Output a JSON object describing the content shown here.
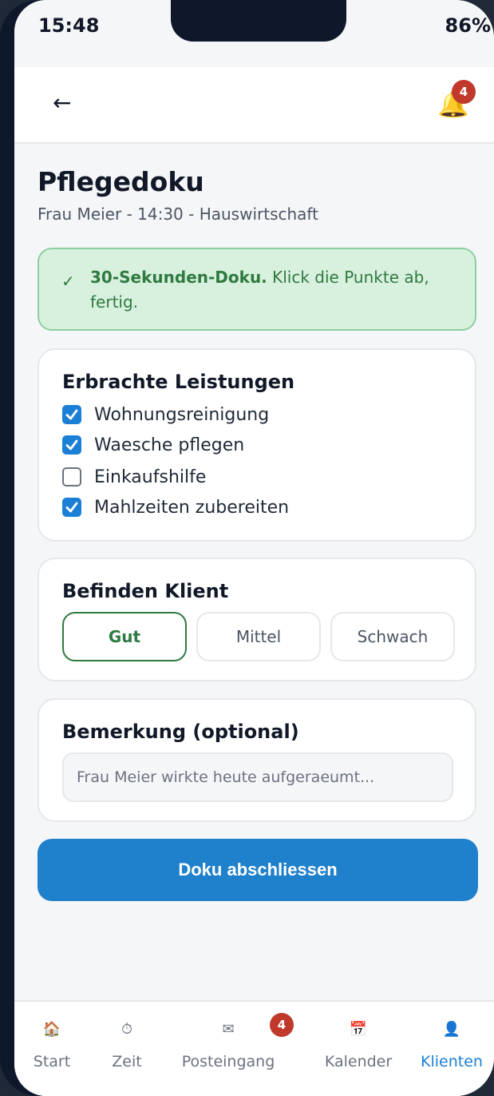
{
  "status": {
    "time": "15:48",
    "battery": "86%"
  },
  "header": {
    "back_icon": "←",
    "bell_icon": "🔔",
    "notification_count": "4"
  },
  "page": {
    "title": "Pflegedoku",
    "subtitle": "Frau Meier - 14:30 - Hauswirtschaft"
  },
  "tip": {
    "check": "✓",
    "bold": "30-Sekunden-Doku.",
    "text": " Klick die Punkte ab, fertig."
  },
  "services": {
    "title": "Erbrachte Leistungen",
    "items": [
      {
        "label": "Wohnungsreinigung",
        "checked": true
      },
      {
        "label": "Waesche pflegen",
        "checked": true
      },
      {
        "label": "Einkaufshilfe",
        "checked": false
      },
      {
        "label": "Mahlzeiten zubereiten",
        "checked": true
      }
    ]
  },
  "condition": {
    "title": "Befinden Klient",
    "options": [
      "Gut",
      "Mittel",
      "Schwach"
    ],
    "selected": "Gut"
  },
  "remark": {
    "title": "Bemerkung (optional)",
    "placeholder": "Frau Meier wirkte heute aufgeraeumt..."
  },
  "submit": {
    "label": "Doku abschliessen"
  },
  "tabs": [
    {
      "label": "Start",
      "icon": "🏠"
    },
    {
      "label": "Zeit",
      "icon": "⏱"
    },
    {
      "label": "Posteingang",
      "icon": "✉",
      "badge": "4"
    },
    {
      "label": "Kalender",
      "icon": "📅"
    },
    {
      "label": "Klienten",
      "icon": "👤",
      "active": true
    }
  ],
  "colors": {
    "accent": "#1b7fd6",
    "success": "#2f7a40",
    "badge": "#c0392b"
  }
}
